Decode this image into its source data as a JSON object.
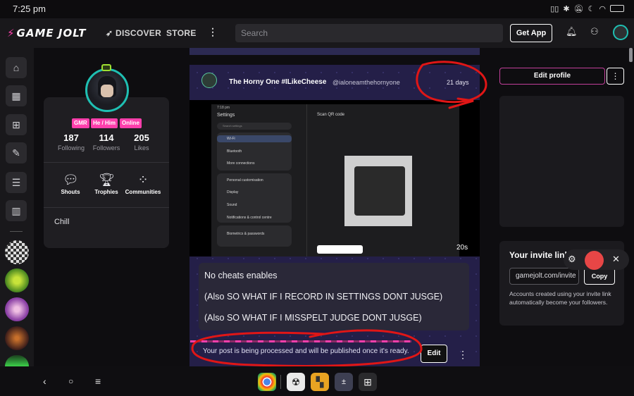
{
  "status_bar": {
    "time": "7:25 pm",
    "icons": [
      "vibrate-icon",
      "bluetooth-icon",
      "mute-icon",
      "night-mode-icon",
      "wifi-icon",
      "battery-icon"
    ]
  },
  "topnav": {
    "logo": "GAME JOLT",
    "discover": "DISCOVER",
    "store": "STORE",
    "search_placeholder": "Search",
    "get_app": "Get App"
  },
  "profile": {
    "tags": [
      "GMR",
      "He / Him",
      "Online"
    ],
    "stats": [
      {
        "value": "187",
        "label": "Following"
      },
      {
        "value": "114",
        "label": "Followers"
      },
      {
        "value": "205",
        "label": "Likes"
      }
    ],
    "sections": [
      {
        "label": "Shouts",
        "icon": "chat-bubble-icon"
      },
      {
        "label": "Trophies",
        "icon": "trophy-icon"
      },
      {
        "label": "Communities",
        "icon": "communities-icon"
      }
    ],
    "bio": "Chill"
  },
  "post": {
    "author": "The Horny One #ILikeCheese",
    "handle": "@ialoneamthehornyone",
    "time": "21 days",
    "video_duration": "20s",
    "screenshot": {
      "status_time": "7:18 pm",
      "settings_title": "Settings",
      "search_settings": "Search settings",
      "rows": [
        "Wi-Fi",
        "Bluetooth",
        "More connections",
        "Personal customisation",
        "Display",
        "Sound",
        "Notifications & control centre",
        "Biometrics & passwords"
      ],
      "qr_title": "Scan QR code"
    },
    "lines": [
      "No cheats enables",
      "(Also SO WHAT IF I RECORD IN SETTINGS DONT JUSGE)",
      "(Also SO WHAT IF I MISSPELT JUDGE DONT JUSGE)"
    ],
    "processing_text": "Your post is being processed and will be published once it's ready.",
    "edit_label": "Edit"
  },
  "right": {
    "edit_profile": "Edit profile",
    "invite_title": "Your invite link",
    "invite_value": "gamejolt.com/invite",
    "copy_label": "Copy",
    "invite_desc": "Accounts created using your invite link automatically become your followers."
  },
  "colors": {
    "accent": "#ff3fac",
    "annotation": "#e01616",
    "post_bg": "#241f48"
  }
}
